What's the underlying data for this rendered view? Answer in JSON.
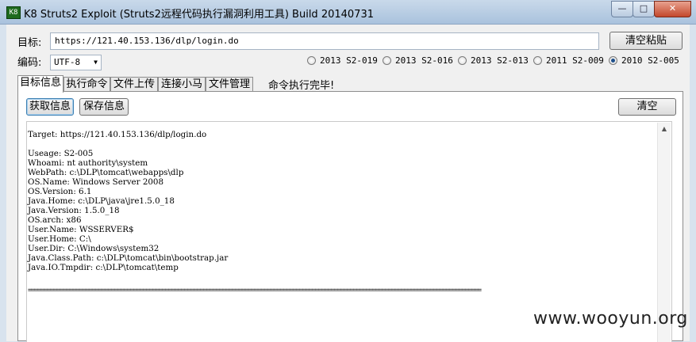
{
  "window": {
    "icon_text": "K8",
    "title": "K8 Struts2 Exploit (Struts2远程代码执行漏洞利用工具) Build 20140731",
    "min_label": "—",
    "max_label": "□",
    "close_label": "✕"
  },
  "target": {
    "label": "目标:",
    "value": "https://121.40.153.136/dlp/login.do",
    "clear_paste_label": "清空粘贴"
  },
  "encoding": {
    "label": "编码:",
    "selected": "UTF-8"
  },
  "exploits": [
    {
      "label": "2013 S2-019",
      "selected": false
    },
    {
      "label": "2013 S2-016",
      "selected": false
    },
    {
      "label": "2013 S2-013",
      "selected": false
    },
    {
      "label": "2011 S2-009",
      "selected": false
    },
    {
      "label": "2010 S2-005",
      "selected": true
    }
  ],
  "tabs": [
    "目标信息",
    "执行命令",
    "文件上传",
    "连接小马",
    "文件管理"
  ],
  "active_tab": 0,
  "status_text": "命令执行完毕!",
  "toolbar": {
    "get_info_label": "获取信息",
    "save_info_label": "保存信息",
    "clear_label": "清空"
  },
  "output": {
    "text": "Target: https://121.40.153.136/dlp/login.do\n\nUseage: S2-005\nWhoami: nt authority\\system\nWebPath: c:\\DLP\\tomcat\\webapps\\dlp\nOS.Name: Windows Server 2008\nOS.Version: 6.1\nJava.Home: c:\\DLP\\java\\jre1.5.0_18\nJava.Version: 1.5.0_18\nOS.arch: x86\nUser.Name: WSSERVER$\nUser.Home: C:\\\nUser.Dir: C:\\Windows\\system32\nJava.Class.Path: c:\\DLP\\tomcat\\bin\\bootstrap.jar\nJava.IO.Tmpdir: c:\\DLP\\tomcat\\temp",
    "separator": "=============================================================================================================================================="
  },
  "watermark": "www.wooyun.org"
}
